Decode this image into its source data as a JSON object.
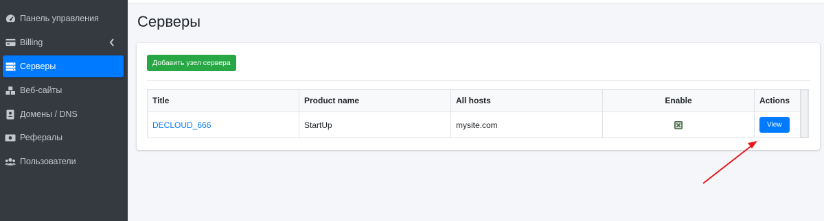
{
  "sidebar": {
    "items": [
      {
        "label": "Панель управления",
        "icon": "tachometer-icon",
        "active": false
      },
      {
        "label": "Billing",
        "icon": "credit-card-icon",
        "active": false,
        "has_submenu": true
      },
      {
        "label": "Серверы",
        "icon": "server-icon",
        "active": true
      },
      {
        "label": "Веб-сайты",
        "icon": "cubes-icon",
        "active": false
      },
      {
        "label": "Домены / DNS",
        "icon": "address-book-icon",
        "active": false
      },
      {
        "label": "Рефералы",
        "icon": "money-bill-icon",
        "active": false
      },
      {
        "label": "Пользователи",
        "icon": "users-icon",
        "active": false
      }
    ]
  },
  "page": {
    "title": "Серверы"
  },
  "toolbar": {
    "add_label": "Добавить узел сервера"
  },
  "table": {
    "columns": [
      "Title",
      "Product name",
      "All hosts",
      "Enable",
      "Actions"
    ],
    "rows": [
      {
        "title": "DECLOUD_666",
        "product_name": "StartUp",
        "all_hosts": "mysite.com",
        "enable": "checked-box-icon",
        "action_label": "View"
      }
    ]
  },
  "colors": {
    "sidebar_bg": "#343a40",
    "sidebar_text": "#c2c7d0",
    "active": "#007bff",
    "success": "#28a745",
    "link": "#007bff",
    "annotation_arrow": "#e8181d"
  }
}
